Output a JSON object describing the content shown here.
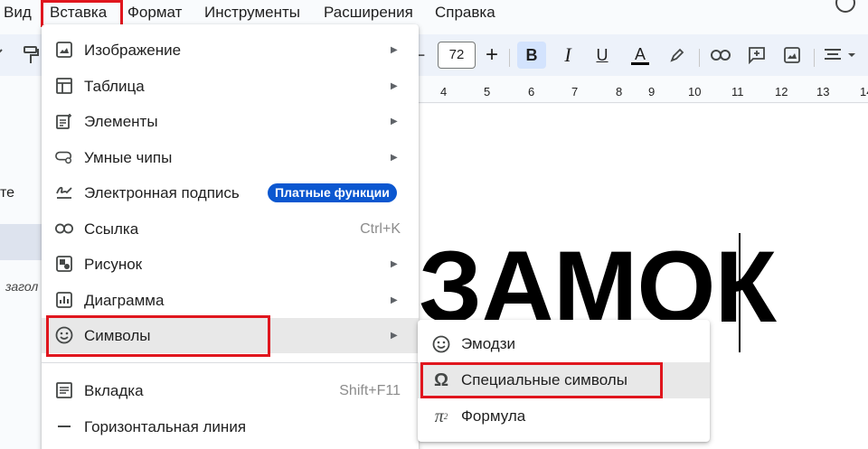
{
  "menubar": {
    "items": [
      "Вид",
      "Вставка",
      "Формат",
      "Инструменты",
      "Расширения",
      "Справка"
    ]
  },
  "toolbar": {
    "font_size": "72",
    "minus": "−",
    "plus": "+",
    "bold": "B",
    "italic": "I",
    "underline": "U",
    "text_color": "A"
  },
  "ruler": {
    "numbers": [
      "4",
      "5",
      "6",
      "7",
      "8",
      "9",
      "10",
      "11",
      "12",
      "13",
      "14"
    ]
  },
  "left_panel": {
    "text_fragment": "те",
    "italic_fragment": "загол"
  },
  "document": {
    "big_text": "ЗАМОК"
  },
  "insert_menu": {
    "items": [
      {
        "label": "Изображение",
        "icon": "image-icon",
        "submenu": true
      },
      {
        "label": "Таблица",
        "icon": "table-icon",
        "submenu": true
      },
      {
        "label": "Элементы",
        "icon": "building-blocks-icon",
        "submenu": true
      },
      {
        "label": "Умные чипы",
        "icon": "smart-chip-icon",
        "submenu": true
      },
      {
        "label": "Электронная подпись",
        "icon": "signature-icon",
        "badge": "Платные функции"
      },
      {
        "label": "Ссылка",
        "icon": "link-icon",
        "shortcut": "Ctrl+K"
      },
      {
        "label": "Рисунок",
        "icon": "drawing-icon",
        "submenu": true
      },
      {
        "label": "Диаграмма",
        "icon": "chart-icon",
        "submenu": true
      },
      {
        "label": "Символы",
        "icon": "smiley-icon",
        "submenu": true,
        "active": true
      },
      {
        "label": "Вкладка",
        "icon": "tab-icon",
        "shortcut": "Shift+F11"
      },
      {
        "label": "Горизонтальная линия",
        "icon": "horizontal-line-icon"
      }
    ]
  },
  "symbols_submenu": {
    "items": [
      {
        "label": "Эмодзи",
        "icon": "emoji-icon"
      },
      {
        "label": "Специальные символы",
        "icon": "omega-icon",
        "active": true
      },
      {
        "label": "Формула",
        "icon": "pi-icon"
      }
    ]
  },
  "colors": {
    "highlight_red": "#e0161e",
    "badge_blue": "#0b57d0",
    "toolbar_bg": "#edf2fa",
    "bold_active": "#d3e3fd"
  }
}
